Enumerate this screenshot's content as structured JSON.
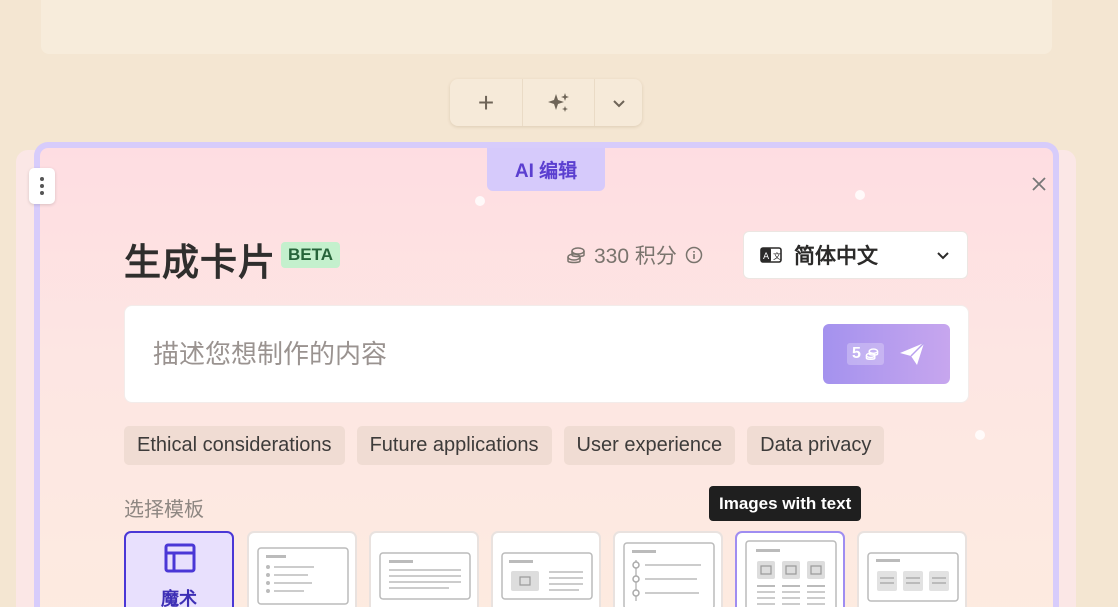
{
  "toolbar": {
    "add_icon": "plus-icon",
    "ai_icon": "sparkles-icon",
    "more_icon": "chevron-down-icon"
  },
  "panel": {
    "tab_label": "AI 编辑",
    "title": "生成卡片",
    "badge": "BETA",
    "credits": "330 积分",
    "language": "简体中文",
    "prompt_placeholder": "描述您想制作的内容",
    "send_cost": "5",
    "suggestions": [
      "Ethical considerations",
      "Future applications",
      "User experience",
      "Data privacy"
    ],
    "templates_label": "选择模板",
    "magic_template_label": "魔术",
    "tooltip": "Images with text"
  },
  "colors": {
    "accent": "#5b3fd0",
    "panel_border": "#d7ccfb",
    "beta_bg": "#c4f0cd",
    "background": "#f4e6d2"
  }
}
